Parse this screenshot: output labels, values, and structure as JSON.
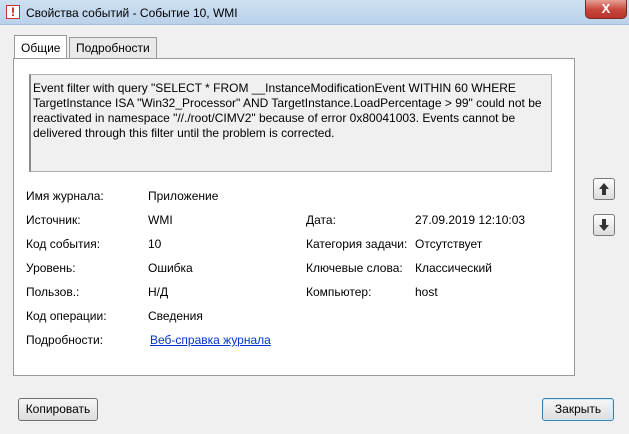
{
  "window": {
    "title": "Свойства событий - Событие 10, WMI",
    "close_glyph": "X"
  },
  "tabs": [
    {
      "label": "Общие",
      "active": true
    },
    {
      "label": "Подробности",
      "active": false
    }
  ],
  "description": "Event filter with query \"SELECT * FROM __InstanceModificationEvent WITHIN 60 WHERE TargetInstance ISA \"Win32_Processor\" AND TargetInstance.LoadPercentage > 99\" could not be reactivated in namespace \"//./root/CIMV2\" because of error 0x80041003. Events cannot be delivered through this filter until the problem is corrected.",
  "fields": {
    "log_name": {
      "label": "Имя журнала:",
      "value": "Приложение"
    },
    "source": {
      "label": "Источник:",
      "value": "WMI"
    },
    "date": {
      "label": "Дата:",
      "value": "27.09.2019 12:10:03"
    },
    "event_id": {
      "label": "Код события:",
      "value": "10"
    },
    "task_category": {
      "label": "Категория задачи:",
      "value": "Отсутствует"
    },
    "level": {
      "label": "Уровень:",
      "value": "Ошибка"
    },
    "keywords": {
      "label": "Ключевые слова:",
      "value": "Классический"
    },
    "user": {
      "label": "Пользов.:",
      "value": "Н/Д"
    },
    "computer": {
      "label": "Компьютер:",
      "value": "host"
    },
    "opcode": {
      "label": "Код операции:",
      "value": "Сведения"
    },
    "more_info": {
      "label": "Подробности:",
      "link": "Веб-справка журнала"
    }
  },
  "buttons": {
    "copy": "Копировать",
    "close": "Закрыть"
  },
  "icons": {
    "up": "arrow-up-icon",
    "down": "arrow-down-icon"
  }
}
